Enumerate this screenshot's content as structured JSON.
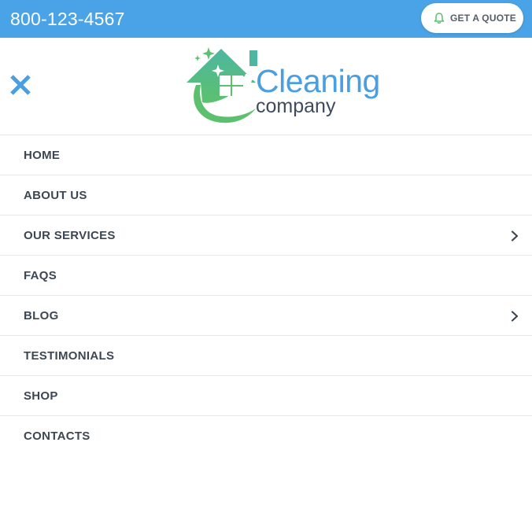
{
  "topbar": {
    "phone": "800-123-4567",
    "quote_button_label": "GET A QUOTE",
    "quote_icon": "bell-icon",
    "background_color": "#4aa3e6"
  },
  "header": {
    "close_icon": "close-icon",
    "logo": {
      "word1": "Cleaning",
      "word2": "company",
      "icon": "house-sparkle-logo-icon",
      "primary_color": "#4a9ee2",
      "green_color": "#5cc16e"
    }
  },
  "menu": {
    "items": [
      {
        "label": "HOME",
        "has_submenu": false
      },
      {
        "label": "ABOUT US",
        "has_submenu": false
      },
      {
        "label": "OUR SERVICES",
        "has_submenu": true
      },
      {
        "label": "FAQS",
        "has_submenu": false
      },
      {
        "label": "BLOG",
        "has_submenu": true
      },
      {
        "label": "TESTIMONIALS",
        "has_submenu": false
      },
      {
        "label": "SHOP",
        "has_submenu": false
      },
      {
        "label": "CONTACTS",
        "has_submenu": false
      }
    ],
    "submenu_icon": "chevron-right-icon"
  }
}
